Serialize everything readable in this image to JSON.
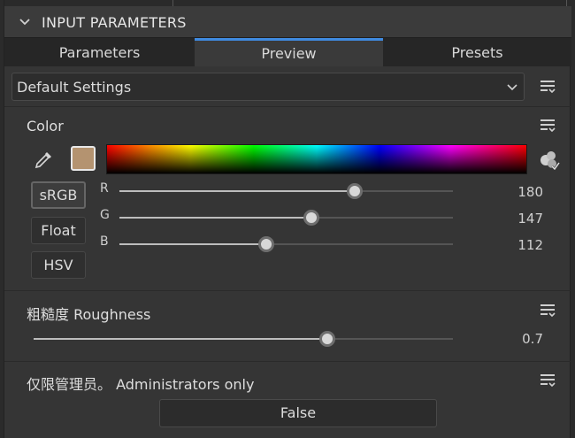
{
  "header": {
    "title": "INPUT PARAMETERS"
  },
  "tabs": [
    {
      "label": "Parameters",
      "active": false
    },
    {
      "label": "Preview",
      "active": true
    },
    {
      "label": "Presets",
      "active": false
    }
  ],
  "preset_dropdown": {
    "value": "Default Settings"
  },
  "color_section": {
    "label": "Color",
    "swatch_color": "#b49370",
    "modes": [
      {
        "label": "sRGB",
        "active": true
      },
      {
        "label": "Float",
        "active": false
      },
      {
        "label": "HSV",
        "active": false
      }
    ],
    "channels": [
      {
        "label": "R",
        "value": "180",
        "fraction": 0.706
      },
      {
        "label": "G",
        "value": "147",
        "fraction": 0.576
      },
      {
        "label": "B",
        "value": "112",
        "fraction": 0.439
      }
    ]
  },
  "roughness": {
    "label": "粗糙度 Roughness",
    "value": "0.7",
    "fraction": 0.7
  },
  "admin": {
    "label": "仅限管理员。 Administrators only",
    "button_label": "False"
  },
  "icons": {
    "collapse": "chevron-down-icon",
    "dropdown_caret": "chevron-down-icon",
    "menu": "menu-options-icon",
    "picker": "eyedropper-icon",
    "palette": "palette-icon"
  },
  "colors": {
    "accent": "#3f8ae0"
  }
}
